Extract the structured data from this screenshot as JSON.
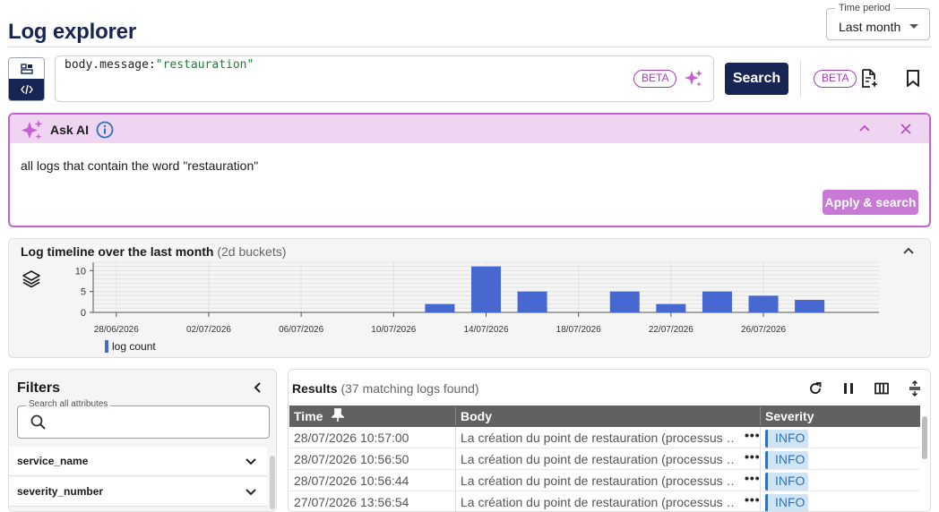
{
  "header": {
    "title": "Log explorer",
    "time_period": {
      "legend": "Time period",
      "value": "Last month"
    }
  },
  "query": {
    "key": "body.message:",
    "value": "\"restauration\"",
    "beta_label": "BETA",
    "search_label": "Search",
    "beta_label_2": "BETA"
  },
  "ask_ai": {
    "title": "Ask AI",
    "prompt": "all logs that contain the word \"restauration\"",
    "apply_label": "Apply & search"
  },
  "timeline": {
    "title": "Log timeline over the last month",
    "bucket": "(2d buckets)",
    "legend_label": "log count"
  },
  "chart_data": {
    "type": "bar",
    "x_tick_labels": [
      "28/06/2026",
      "02/07/2026",
      "06/07/2026",
      "10/07/2026",
      "14/07/2026",
      "18/07/2026",
      "22/07/2026",
      "26/07/2026"
    ],
    "x_tick_dates": [
      "2026-06-28",
      "2026-07-02",
      "2026-07-06",
      "2026-07-10",
      "2026-07-14",
      "2026-07-18",
      "2026-07-22",
      "2026-07-26"
    ],
    "xlim": [
      "2026-06-27",
      "2026-07-31"
    ],
    "ylim": [
      0,
      12
    ],
    "y_ticks": [
      0,
      5,
      10
    ],
    "bucket_days": 2,
    "series": [
      {
        "name": "log count",
        "color": "#4668d0",
        "points": [
          {
            "date": "2026-07-12",
            "value": 2
          },
          {
            "date": "2026-07-14",
            "value": 11
          },
          {
            "date": "2026-07-16",
            "value": 5
          },
          {
            "date": "2026-07-20",
            "value": 5
          },
          {
            "date": "2026-07-22",
            "value": 2
          },
          {
            "date": "2026-07-24",
            "value": 5
          },
          {
            "date": "2026-07-26",
            "value": 4
          },
          {
            "date": "2026-07-28",
            "value": 3
          }
        ]
      }
    ],
    "grid": true
  },
  "filters": {
    "title": "Filters",
    "search_legend": "Search all attributes",
    "facets": [
      {
        "label": "service_name"
      },
      {
        "label": "severity_number"
      }
    ]
  },
  "results": {
    "title": "Results",
    "count_text": "(37 matching logs found)",
    "columns": {
      "time": "Time",
      "body": "Body",
      "severity": "Severity"
    },
    "rows": [
      {
        "time": "28/07/2026 10:57:00",
        "body": "La création du point de restauration (processus …",
        "severity": "INFO"
      },
      {
        "time": "28/07/2026 10:56:50",
        "body": "La création du point de restauration (processus …",
        "severity": "INFO"
      },
      {
        "time": "28/07/2026 10:56:44",
        "body": "La création du point de restauration (processus …",
        "severity": "INFO"
      },
      {
        "time": "27/07/2026 13:56:54",
        "body": "La création du point de restauration (processus …",
        "severity": "INFO"
      }
    ],
    "more_label": "•••"
  },
  "colors": {
    "brand": "#172554",
    "ai_accent": "#c661d1",
    "bar": "#4668d0",
    "severity_info": "#2f72b5"
  }
}
